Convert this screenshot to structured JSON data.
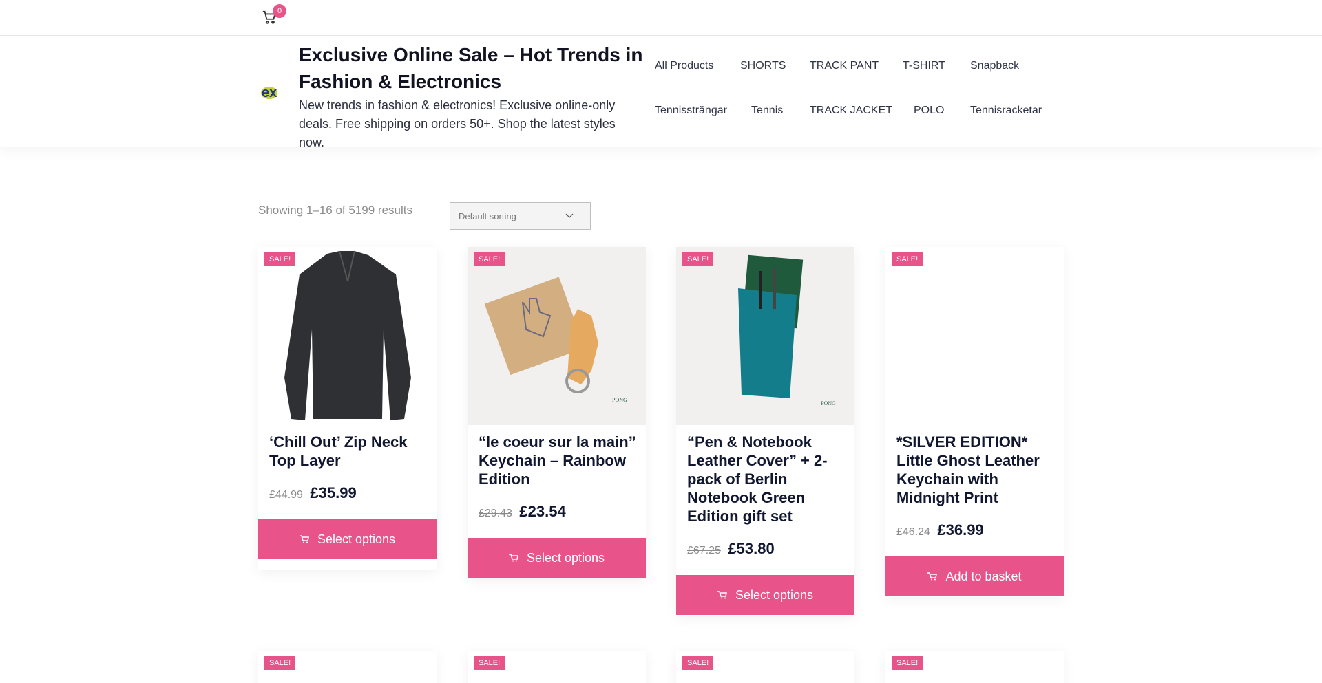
{
  "topbar": {
    "cart_count": "0"
  },
  "header": {
    "site_title": "Exclusive Online Sale – Hot Trends in Fashion & Electronics",
    "site_description": "New trends in fashion & electronics! Exclusive online-only deals. Free shipping on orders 50+. Shop the latest styles now.",
    "logo_text": "ex"
  },
  "nav": {
    "row1": [
      "All Products",
      "SHORTS",
      "TRACK PANT",
      "T-SHIRT",
      "Snapback"
    ],
    "row2": [
      "Tennissträngar",
      "Tennis",
      "TRACK JACKET",
      "POLO",
      "Tennisracketar"
    ]
  },
  "shop": {
    "results_text": "Showing 1–16 of 5199 results",
    "sort_selected": "Default sorting"
  },
  "products": [
    {
      "sale": "SALE!",
      "title": "‘Chill Out’ Zip Neck Top Layer",
      "old_price": "£44.99",
      "price": "£35.99",
      "button": "Select options"
    },
    {
      "sale": "SALE!",
      "title": "“le coeur sur la main” Keychain – Rainbow Edition",
      "old_price": "£29.43",
      "price": "£23.54",
      "button": "Select options"
    },
    {
      "sale": "SALE!",
      "title": "“Pen & Notebook Leather Cover” + 2-pack of Berlin Notebook Green Edition gift set",
      "old_price": "£67.25",
      "price": "£53.80",
      "button": "Select options"
    },
    {
      "sale": "SALE!",
      "title": "*SILVER EDITION* Little Ghost Leather Keychain with Midnight Print",
      "old_price": "£46.24",
      "price": "£36.99",
      "button": "Add to basket"
    }
  ],
  "row2_badges": [
    "SALE!",
    "SALE!",
    "SALE!",
    "SALE!"
  ],
  "colors": {
    "accent": "#e8538a",
    "text_dark": "#111730",
    "muted": "#8b8b8b"
  }
}
